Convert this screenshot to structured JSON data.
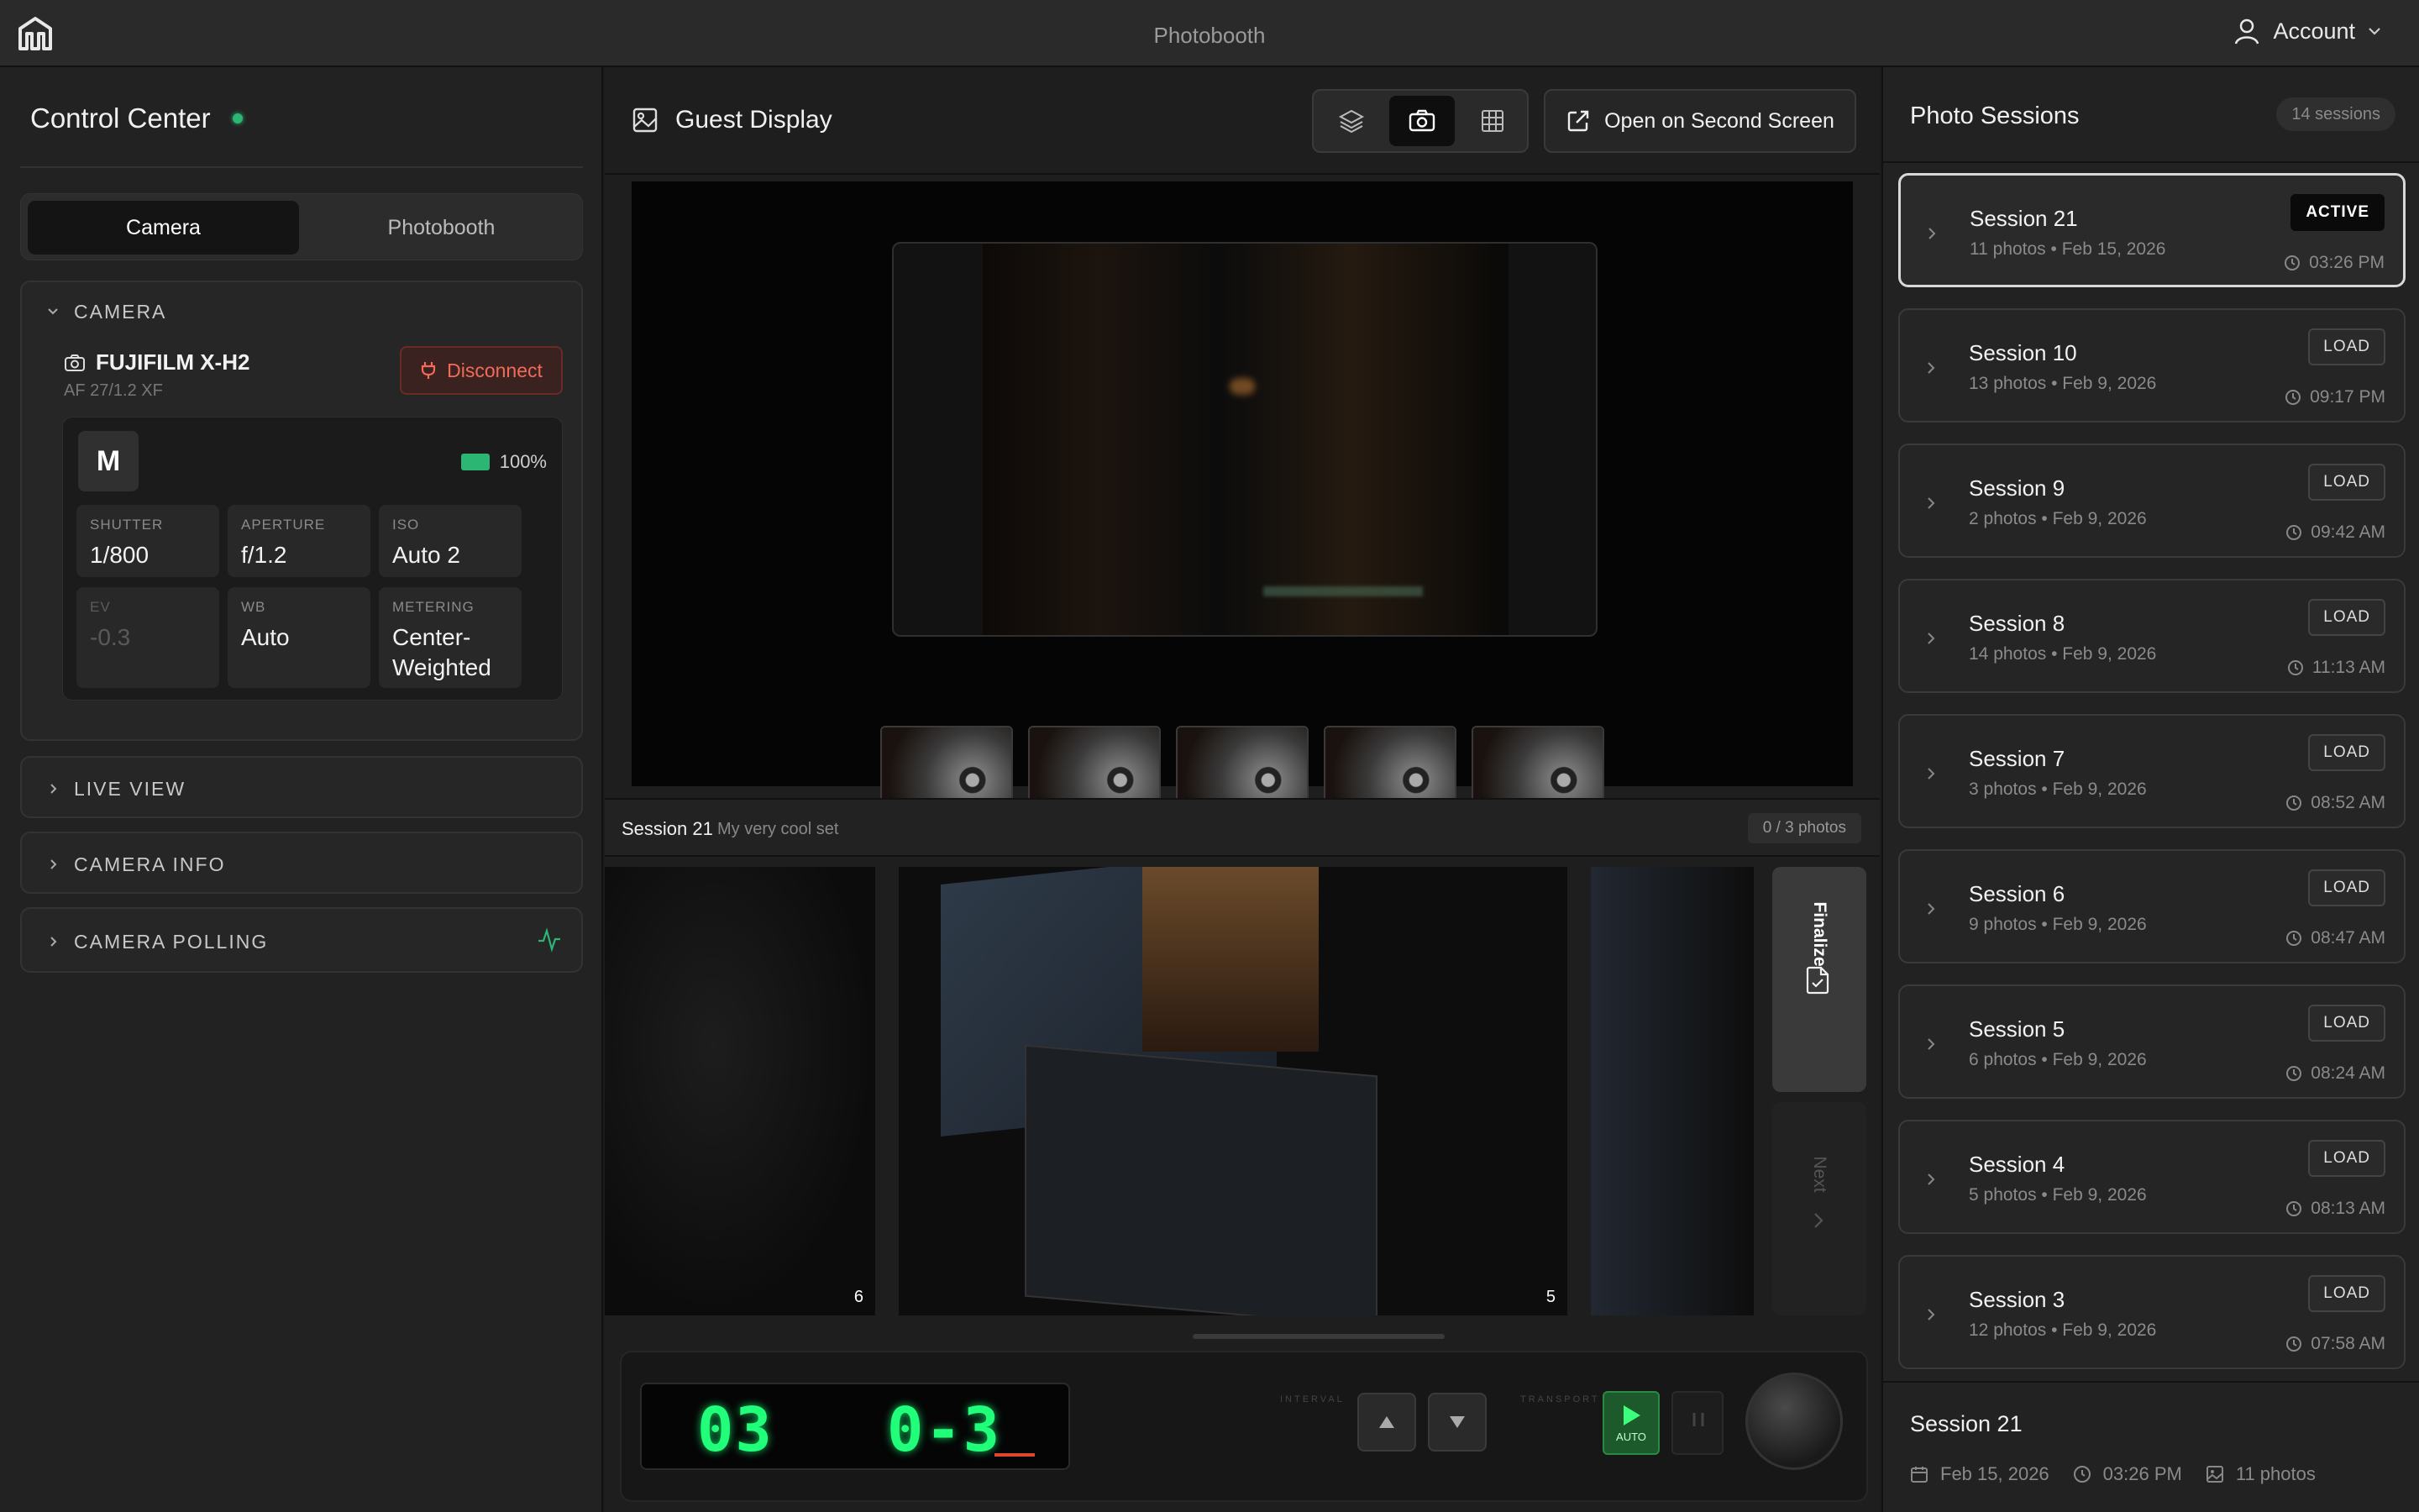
{
  "app": {
    "title": "Photobooth",
    "account_label": "Account"
  },
  "left": {
    "title": "Control Center",
    "tabs": [
      "Camera",
      "Photobooth"
    ],
    "camera_section": "CAMERA",
    "camera_name": "FUJIFILM X-H2",
    "lens": "AF 27/1.2 XF",
    "disconnect_label": "Disconnect",
    "mode": "M",
    "battery": "100%",
    "settings": [
      {
        "k": "SHUTTER",
        "v": "1/800"
      },
      {
        "k": "APERTURE",
        "v": "f/1.2"
      },
      {
        "k": "ISO",
        "v": "Auto 2"
      },
      {
        "k": "EV",
        "v": "-0.3"
      },
      {
        "k": "WB",
        "v": "Auto"
      },
      {
        "k": "METERING",
        "v": "Center-Weighted"
      }
    ],
    "sections": [
      "LIVE VIEW",
      "CAMERA INFO",
      "CAMERA POLLING"
    ]
  },
  "center": {
    "title": "Guest Display",
    "second_screen_label": "Open on Second Screen",
    "session_name": "Session 21",
    "session_desc": "My very cool set",
    "photo_count": "0 / 3 photos",
    "photo_numbers": [
      "6",
      "5"
    ],
    "finalize_label": "Finalize",
    "next_label": "Next",
    "console": {
      "interval": "03",
      "shots": "0-3",
      "interval_label": "INTERVAL",
      "transport_label": "TRANSPORT",
      "auto_label": "AUTO"
    }
  },
  "right": {
    "title": "Photo Sessions",
    "count": "14 sessions",
    "sessions": [
      {
        "name": "Session 21",
        "sub": "11 photos • Feb 15, 2026",
        "time": "03:26 PM",
        "btn": "ACTIVE",
        "active": true
      },
      {
        "name": "Session 10",
        "sub": "13 photos • Feb 9, 2026",
        "time": "09:17 PM",
        "btn": "LOAD"
      },
      {
        "name": "Session 9",
        "sub": "2 photos • Feb 9, 2026",
        "time": "09:42 AM",
        "btn": "LOAD"
      },
      {
        "name": "Session 8",
        "sub": "14 photos • Feb 9, 2026",
        "time": "11:13 AM",
        "btn": "LOAD"
      },
      {
        "name": "Session 7",
        "sub": "3 photos • Feb 9, 2026",
        "time": "08:52 AM",
        "btn": "LOAD"
      },
      {
        "name": "Session 6",
        "sub": "9 photos • Feb 9, 2026",
        "time": "08:47 AM",
        "btn": "LOAD"
      },
      {
        "name": "Session 5",
        "sub": "6 photos • Feb 9, 2026",
        "time": "08:24 AM",
        "btn": "LOAD"
      },
      {
        "name": "Session 4",
        "sub": "5 photos • Feb 9, 2026",
        "time": "08:13 AM",
        "btn": "LOAD"
      },
      {
        "name": "Session 3",
        "sub": "12 photos • Feb 9, 2026",
        "time": "07:58 AM",
        "btn": "LOAD"
      }
    ],
    "footer": {
      "name": "Session 21",
      "date": "Feb 15, 2026",
      "time": "03:26 PM",
      "photos": "11 photos"
    }
  }
}
